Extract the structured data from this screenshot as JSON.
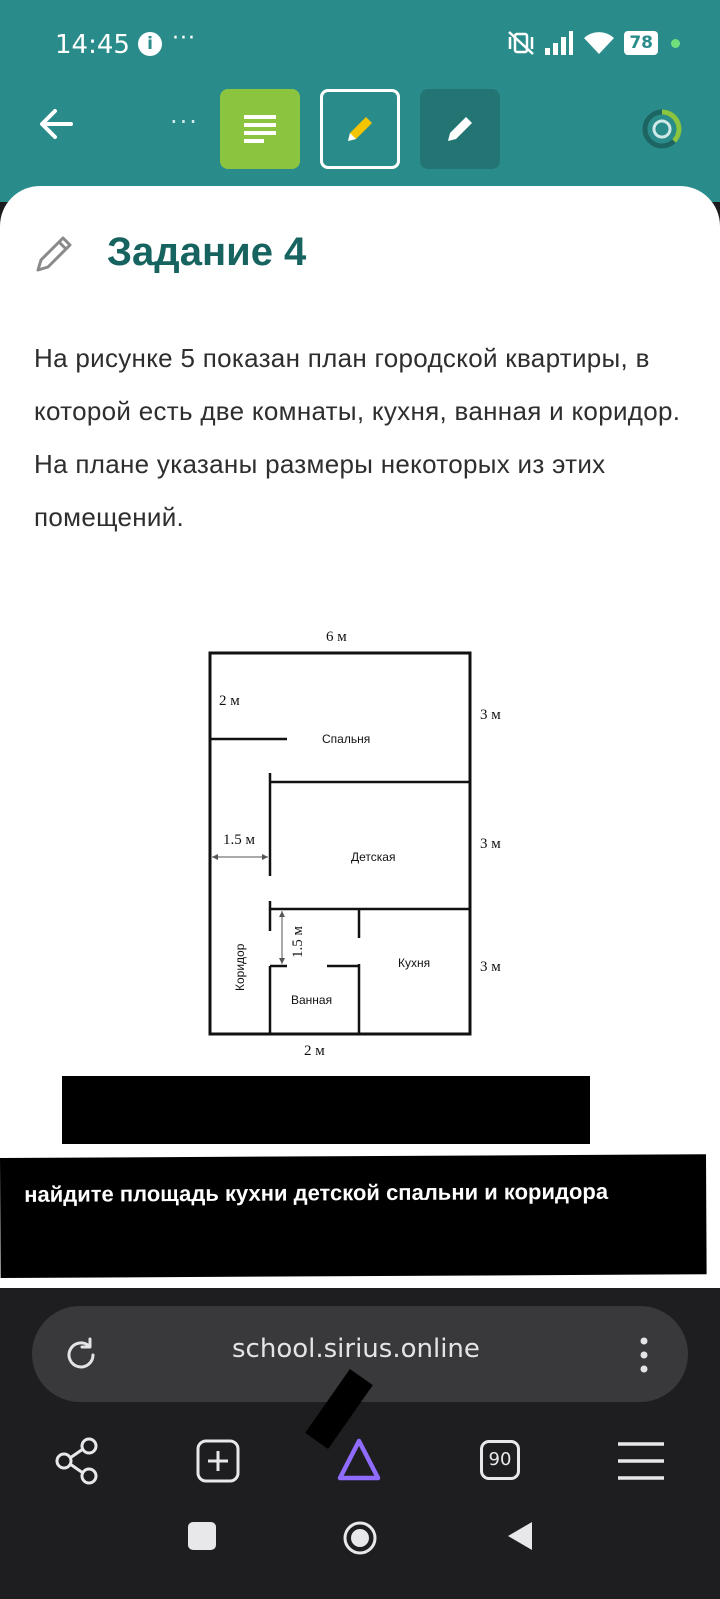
{
  "status": {
    "time": "14:45",
    "info_icon": "i",
    "dots": "···",
    "battery": "78"
  },
  "toolbar": {
    "more": "···"
  },
  "task": {
    "title": "Задание 4",
    "text": "На рисунке 5 показан план городской квартиры, в которой есть две комнаты, кухня, ванная и коридор. На плане указаны размеры некоторых из этих помещений."
  },
  "plan": {
    "top_width": "6 м",
    "corridor_top_width": "2 м",
    "bedroom_height": "3 м",
    "kids_height": "3 м",
    "kitchen_height": "3 м",
    "corridor_width_mid": "1.5 м",
    "bath_height": "1.5 м",
    "bottom_width": "2 м",
    "rooms": {
      "bedroom": "Спальня",
      "kids": "Детская",
      "kitchen": "Кухня",
      "bath": "Ванная",
      "corridor": "Коридор"
    }
  },
  "question": {
    "text": "найдите площадь кухни детской спальни и коридора"
  },
  "browser": {
    "url": "school.sirius.online",
    "tabs_count": "90"
  },
  "colors": {
    "teal": "#2a8c8a",
    "green_button": "#8bc53f",
    "title": "#17635f"
  }
}
